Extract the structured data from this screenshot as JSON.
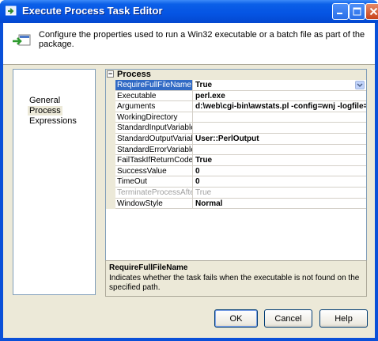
{
  "window": {
    "title": "Execute Process Task Editor"
  },
  "header": {
    "description": "Configure the properties used to run a Win32 executable or a batch file as part of the package."
  },
  "nav": {
    "items": [
      {
        "label": "General"
      },
      {
        "label": "Process"
      },
      {
        "label": "Expressions"
      }
    ],
    "selected": "Process"
  },
  "grid": {
    "category": "Process",
    "rows": [
      {
        "name": "RequireFullFileName",
        "value": "True"
      },
      {
        "name": "Executable",
        "value": "perl.exe"
      },
      {
        "name": "Arguments",
        "value": "d:\\web\\cgi-bin\\awstats.pl -config=wnj -logfile="
      },
      {
        "name": "WorkingDirectory",
        "value": ""
      },
      {
        "name": "StandardInputVariable",
        "value": ""
      },
      {
        "name": "StandardOutputVariable",
        "value": "User::PerlOutput"
      },
      {
        "name": "StandardErrorVariable",
        "value": ""
      },
      {
        "name": "FailTaskIfReturnCodeIsN",
        "value": "True"
      },
      {
        "name": "SuccessValue",
        "value": "0"
      },
      {
        "name": "TimeOut",
        "value": "0"
      },
      {
        "name": "TerminateProcessAfterTir",
        "value": "True"
      },
      {
        "name": "WindowStyle",
        "value": "Normal"
      }
    ]
  },
  "description_panel": {
    "title": "RequireFullFileName",
    "text": "Indicates whether the task fails when the executable is not found on the specified path."
  },
  "buttons": {
    "ok": "OK",
    "cancel": "Cancel",
    "help": "Help"
  },
  "colors": {
    "title_bar": "#0554e3",
    "selection": "#316ac5",
    "dialog_bg": "#ece9d8"
  }
}
